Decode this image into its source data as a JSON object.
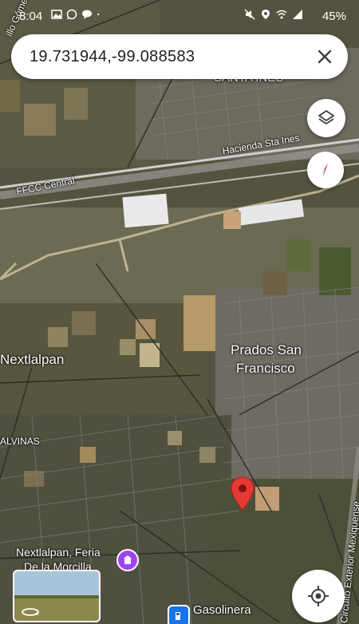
{
  "status_bar": {
    "time": "8:04",
    "battery": "45%",
    "left_icons": [
      "image-icon",
      "whatsapp-icon",
      "chat-icon",
      "dot-icon"
    ],
    "right_icons": [
      "mute-icon",
      "location-icon",
      "wifi-icon",
      "signal-icon"
    ]
  },
  "search": {
    "query": "19.731944,-99.088583",
    "close_icon": "close-icon"
  },
  "map": {
    "labels": {
      "santa_ines": "SANTA INES",
      "hacienda": "Hacienda Sta Ines",
      "ffcc": "FFCC Central",
      "prados_line1": "Prados San",
      "prados_line2": "Francisco",
      "nextlalpan": "Nextlalpan",
      "malvinas": "ALVINAS",
      "feria_line1": "Nextlalpan, Feria",
      "feria_line2": "De la Morcilla",
      "gasolinera": "Gasolinera",
      "circuito": "Circuito Exterior Mexiquense",
      "calle_gomez": "illo Gómez"
    },
    "colors": {
      "pin": "#e53935",
      "poi_purple": "#a142f4",
      "poi_blue": "#1a73e8"
    }
  },
  "controls": {
    "layers_icon": "layers-icon",
    "compass_icon": "compass-icon",
    "location_icon": "my-location-icon",
    "street_view_icon": "street-view-360-icon"
  }
}
